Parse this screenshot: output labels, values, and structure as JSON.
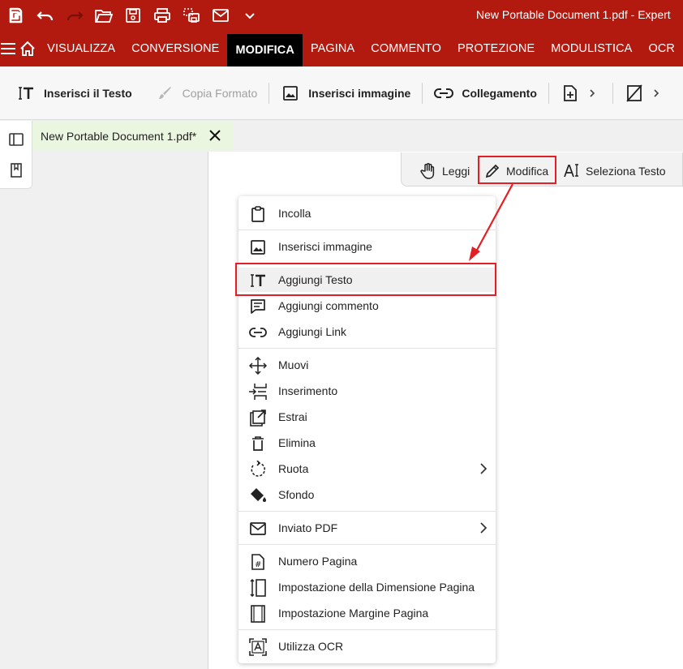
{
  "window": {
    "title": "New Portable Document 1.pdf  -  Expert",
    "quick_access_icons": [
      "app-logo-icon",
      "undo-icon",
      "redo-icon",
      "open-folder-icon",
      "save-icon",
      "print-icon",
      "scan-icon",
      "email-icon",
      "chevron-down-icon"
    ]
  },
  "menubar": {
    "tabs": [
      "VISUALIZZA",
      "CONVERSIONE",
      "MODIFICA",
      "PAGINA",
      "COMMENTO",
      "PROTEZIONE",
      "MODULISTICA",
      "OCR"
    ],
    "active": "MODIFICA"
  },
  "toolbar": {
    "insert_text": "Inserisci il Testo",
    "copy_format": "Copia Formato",
    "insert_image": "Inserisci immagine",
    "link": "Collegamento"
  },
  "document_tab": {
    "name": "New Portable Document 1.pdf*"
  },
  "modes": {
    "read": "Leggi",
    "edit": "Modifica",
    "select_text": "Seleziona Testo"
  },
  "context_menu": {
    "items": [
      {
        "label": "Incolla",
        "icon": "clipboard-icon"
      },
      {
        "label": "Inserisci immagine",
        "icon": "image-icon"
      },
      {
        "label": "Aggiungi Testo",
        "icon": "add-text-icon"
      },
      {
        "label": "Aggiungi commento",
        "icon": "comment-icon"
      },
      {
        "label": "Aggiungi Link",
        "icon": "link-icon"
      },
      {
        "label": "Muovi",
        "icon": "move-icon"
      },
      {
        "label": "Inserimento",
        "icon": "insert-icon"
      },
      {
        "label": "Estrai",
        "icon": "extract-icon"
      },
      {
        "label": "Elimina",
        "icon": "trash-icon"
      },
      {
        "label": "Ruota",
        "icon": "rotate-icon"
      },
      {
        "label": "Sfondo",
        "icon": "paint-bucket-icon"
      },
      {
        "label": "Inviato PDF",
        "icon": "email-icon"
      },
      {
        "label": "Numero Pagina",
        "icon": "page-number-icon"
      },
      {
        "label": "Impostazione della Dimensione Pagina",
        "icon": "page-size-icon"
      },
      {
        "label": "Impostazione Margine Pagina",
        "icon": "page-margin-icon"
      },
      {
        "label": "Utilizza OCR",
        "icon": "ocr-icon"
      }
    ]
  },
  "colors": {
    "brand_red": "#b31a0f",
    "highlight_red": "#e31e24",
    "tab_green": "#eaf6df"
  }
}
